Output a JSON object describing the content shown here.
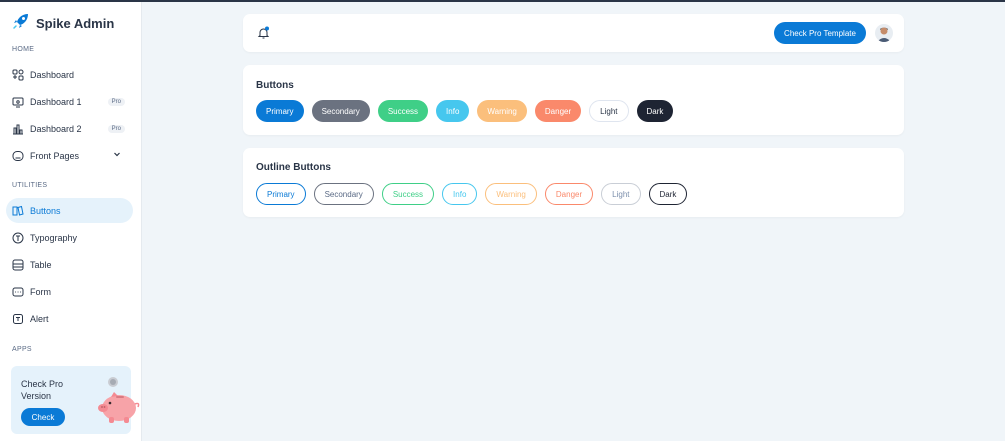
{
  "brand": {
    "name": "Spike Admin"
  },
  "sidebar": {
    "sections": {
      "home": "HOME",
      "utilities": "UTILITIES",
      "apps": "APPS"
    },
    "home_items": [
      {
        "label": "Dashboard",
        "icon": "layout-grid-icon",
        "badge": ""
      },
      {
        "label": "Dashboard 1",
        "icon": "screen-share-icon",
        "badge": "Pro"
      },
      {
        "label": "Dashboard 2",
        "icon": "chart-bar-icon",
        "badge": "Pro"
      },
      {
        "label": "Front Pages",
        "icon": "app-window-icon",
        "badge": ""
      }
    ],
    "utility_items": [
      {
        "label": "Buttons",
        "icon": "book-icon",
        "active": true
      },
      {
        "label": "Typography",
        "icon": "typography-icon"
      },
      {
        "label": "Table",
        "icon": "table-icon"
      },
      {
        "label": "Form",
        "icon": "form-icon"
      },
      {
        "label": "Alert",
        "icon": "alert-icon"
      }
    ]
  },
  "promo": {
    "title": "Check Pro Version",
    "button": "Check"
  },
  "header": {
    "pro_button": "Check Pro Template"
  },
  "buttons_card": {
    "title": "Buttons",
    "buttons": [
      "Primary",
      "Secondary",
      "Success",
      "Info",
      "Warning",
      "Danger",
      "Light",
      "Dark"
    ]
  },
  "outline_card": {
    "title": "Outline Buttons",
    "buttons": [
      "Primary",
      "Secondary",
      "Success",
      "Info",
      "Warning",
      "Danger",
      "Light",
      "Dark"
    ]
  },
  "colors": {
    "primary": "#0a7ad6",
    "secondary": "#6b7280",
    "success": "#3fcf87",
    "info": "#46c7ee",
    "warning": "#fbbf7c",
    "danger": "#fa896b",
    "light": "#ffffff",
    "dark": "#1e2433",
    "active_bg": "#e5f2fb"
  }
}
